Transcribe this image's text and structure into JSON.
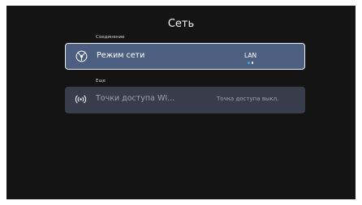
{
  "page": {
    "title": "Сеть"
  },
  "sections": {
    "connection": {
      "label": "Соединение"
    },
    "more": {
      "label": "Еще"
    }
  },
  "rows": {
    "network_mode": {
      "label": "Режим сети",
      "value": "LAN",
      "icon": "network-globe-icon",
      "options_indicator": {
        "count": 2,
        "selected_index": 0
      }
    },
    "hotspot": {
      "label": "Точки доступа WI...",
      "value": "Точка доступа выкл.",
      "icon": "wifi-hotspot-icon"
    }
  },
  "colors": {
    "background": "#141414",
    "selected_row": "#4d5f80",
    "selected_border": "#eef1f6",
    "row": "#383d4b",
    "accent_dot": "#2fa5e0",
    "inactive_dot": "#ffffff"
  }
}
